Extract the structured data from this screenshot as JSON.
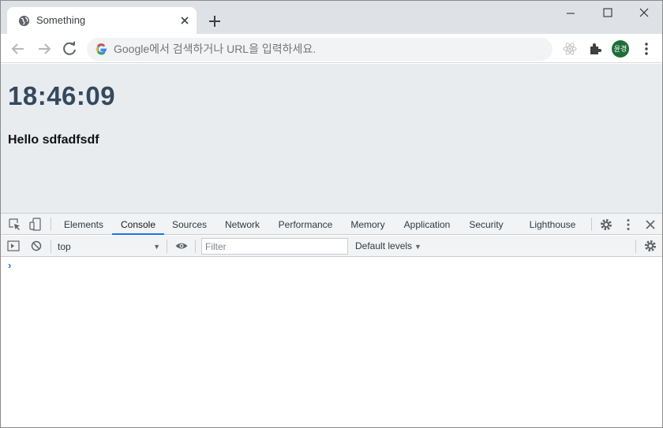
{
  "browser": {
    "tab_title": "Something",
    "omnibox_placeholder": "Google에서 검색하거나 URL을 입력하세요.",
    "profile_initials": "윤경",
    "profile_color": "#1e6e3a"
  },
  "page": {
    "clock": "18:46:09",
    "greeting": "Hello sdfadfsdf"
  },
  "devtools": {
    "tabs": [
      "Elements",
      "Console",
      "Sources",
      "Network",
      "Performance",
      "Memory",
      "Application",
      "Security",
      "Lighthouse"
    ],
    "active_tab": "Console",
    "context": "top",
    "filter_placeholder": "Filter",
    "levels": "Default levels",
    "prompt_symbol": "›"
  }
}
